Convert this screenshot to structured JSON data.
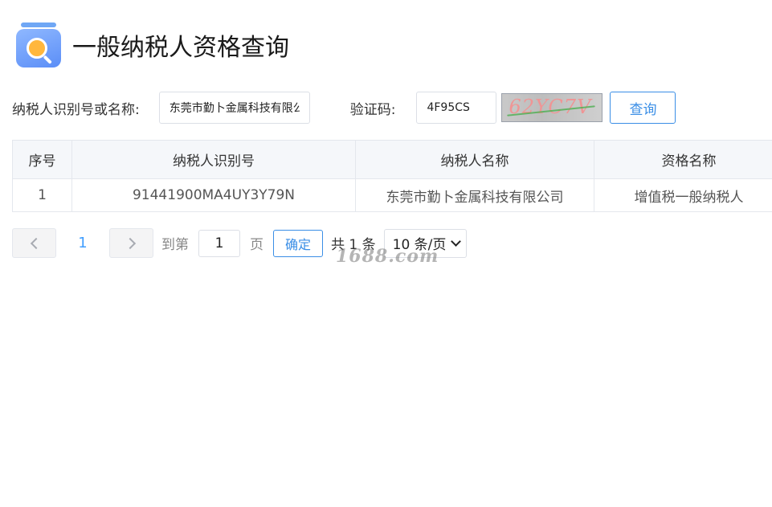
{
  "header": {
    "title": "一般纳税人资格查询",
    "logo_icon": "search-folder-icon"
  },
  "search": {
    "taxpayer_label": "纳税人识别号或名称:",
    "taxpayer_value": "东莞市勤卜金属科技有限公司",
    "captcha_label": "验证码:",
    "captcha_value": "4F95CS",
    "captcha_image_text": "62YC7V",
    "query_label": "查询"
  },
  "table": {
    "headers": [
      "序号",
      "纳税人识别号",
      "纳税人名称",
      "资格名称"
    ],
    "rows": [
      [
        "1",
        "91441900MA4UY3Y79N",
        "东莞市勤卜金属科技有限公司",
        "增值税一般纳税人"
      ]
    ]
  },
  "pagination": {
    "current_page": "1",
    "goto_label": "到第",
    "goto_value": "1",
    "page_unit": "页",
    "confirm_label": "确定",
    "total_text": "共 1 条",
    "page_size": "10 条/页"
  },
  "watermark": "1688.com",
  "colors": {
    "accent": "#3a8ee6",
    "header_bg": "#f5f7fa",
    "border": "#e4e7ed"
  }
}
